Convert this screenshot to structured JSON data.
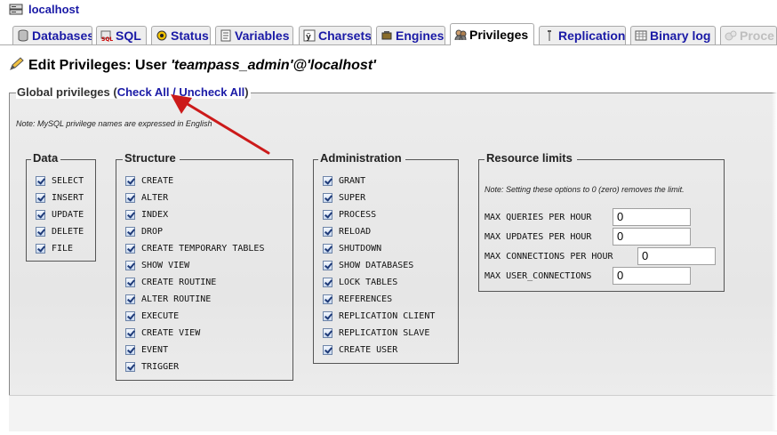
{
  "server": {
    "label": "localhost"
  },
  "tabs": [
    {
      "label": "Databases",
      "icon": "databases-icon"
    },
    {
      "label": "SQL",
      "icon": "sql-icon"
    },
    {
      "label": "Status",
      "icon": "status-icon"
    },
    {
      "label": "Variables",
      "icon": "variables-icon"
    },
    {
      "label": "Charsets",
      "icon": "charsets-icon"
    },
    {
      "label": "Engines",
      "icon": "engines-icon"
    },
    {
      "label": "Privileges",
      "icon": "privileges-icon"
    },
    {
      "label": "Replication",
      "icon": "replication-icon"
    },
    {
      "label": "Binary log",
      "icon": "binary-log-icon"
    },
    {
      "label": "Proce",
      "icon": "processes-icon"
    }
  ],
  "page": {
    "title_prefix": "Edit Privileges: User ",
    "title_user": "'teampass_admin'@'localhost'"
  },
  "global": {
    "legend": "Global privileges (",
    "check_all": "Check All",
    "separator": " / ",
    "uncheck_all": "Uncheck All",
    "legend_end": ")",
    "note": "Note: MySQL privilege names are expressed in English"
  },
  "groups": {
    "data": {
      "legend": "Data",
      "items": [
        "SELECT",
        "INSERT",
        "UPDATE",
        "DELETE",
        "FILE"
      ]
    },
    "structure": {
      "legend": "Structure",
      "items": [
        "CREATE",
        "ALTER",
        "INDEX",
        "DROP",
        "CREATE TEMPORARY TABLES",
        "SHOW VIEW",
        "CREATE ROUTINE",
        "ALTER ROUTINE",
        "EXECUTE",
        "CREATE VIEW",
        "EVENT",
        "TRIGGER"
      ]
    },
    "administration": {
      "legend": "Administration",
      "items": [
        "GRANT",
        "SUPER",
        "PROCESS",
        "RELOAD",
        "SHUTDOWN",
        "SHOW DATABASES",
        "LOCK TABLES",
        "REFERENCES",
        "REPLICATION CLIENT",
        "REPLICATION SLAVE",
        "CREATE USER"
      ]
    }
  },
  "resource_limits": {
    "legend": "Resource limits",
    "note": "Note: Setting these options to 0 (zero) removes the limit.",
    "rows": [
      {
        "label": "MAX QUERIES PER HOUR",
        "value": "0"
      },
      {
        "label": "MAX UPDATES PER HOUR",
        "value": "0"
      },
      {
        "label": "MAX CONNECTIONS PER HOUR",
        "value": "0"
      },
      {
        "label": "MAX USER_CONNECTIONS",
        "value": "0"
      }
    ]
  },
  "annotation": {
    "arrow_color": "#cc1a1a"
  }
}
